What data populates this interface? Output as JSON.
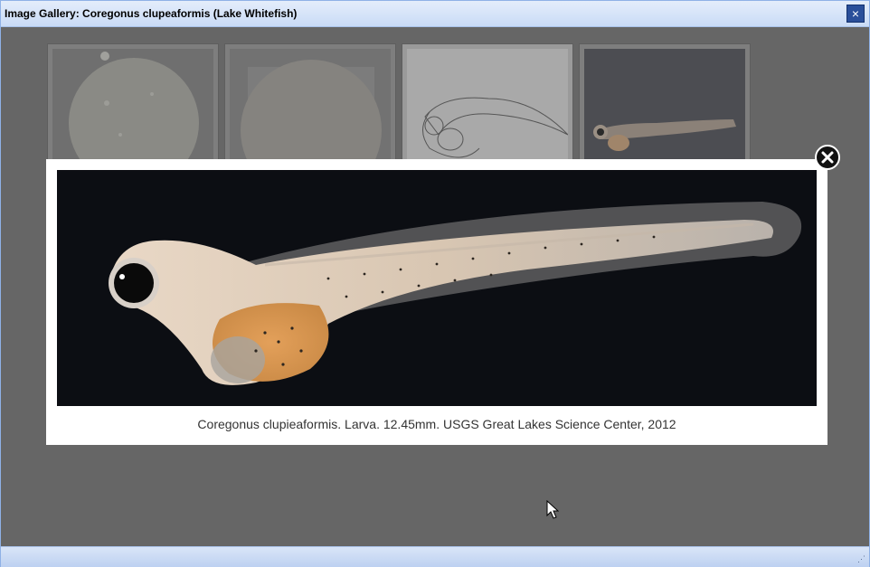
{
  "window": {
    "title": "Image Gallery: Coregonus clupeaformis (Lake Whitefish)",
    "close_icon": "×"
  },
  "thumbnails": [
    {
      "name": "egg",
      "icon": "egg-photo"
    },
    {
      "name": "egg-2",
      "icon": "egg-photo"
    },
    {
      "name": "larva-drawing",
      "icon": "larva-sketch"
    },
    {
      "name": "larva-photo",
      "icon": "larva-photo"
    }
  ],
  "lightbox": {
    "caption": "Coregonus clupieaformis. Larva. 12.45mm. USGS Great Lakes Science Center, 2012",
    "close_icon": "×"
  },
  "colors": {
    "titlebar": "#d6e3f8",
    "overlay": "#666666",
    "close_button": "#2a4f9a"
  }
}
